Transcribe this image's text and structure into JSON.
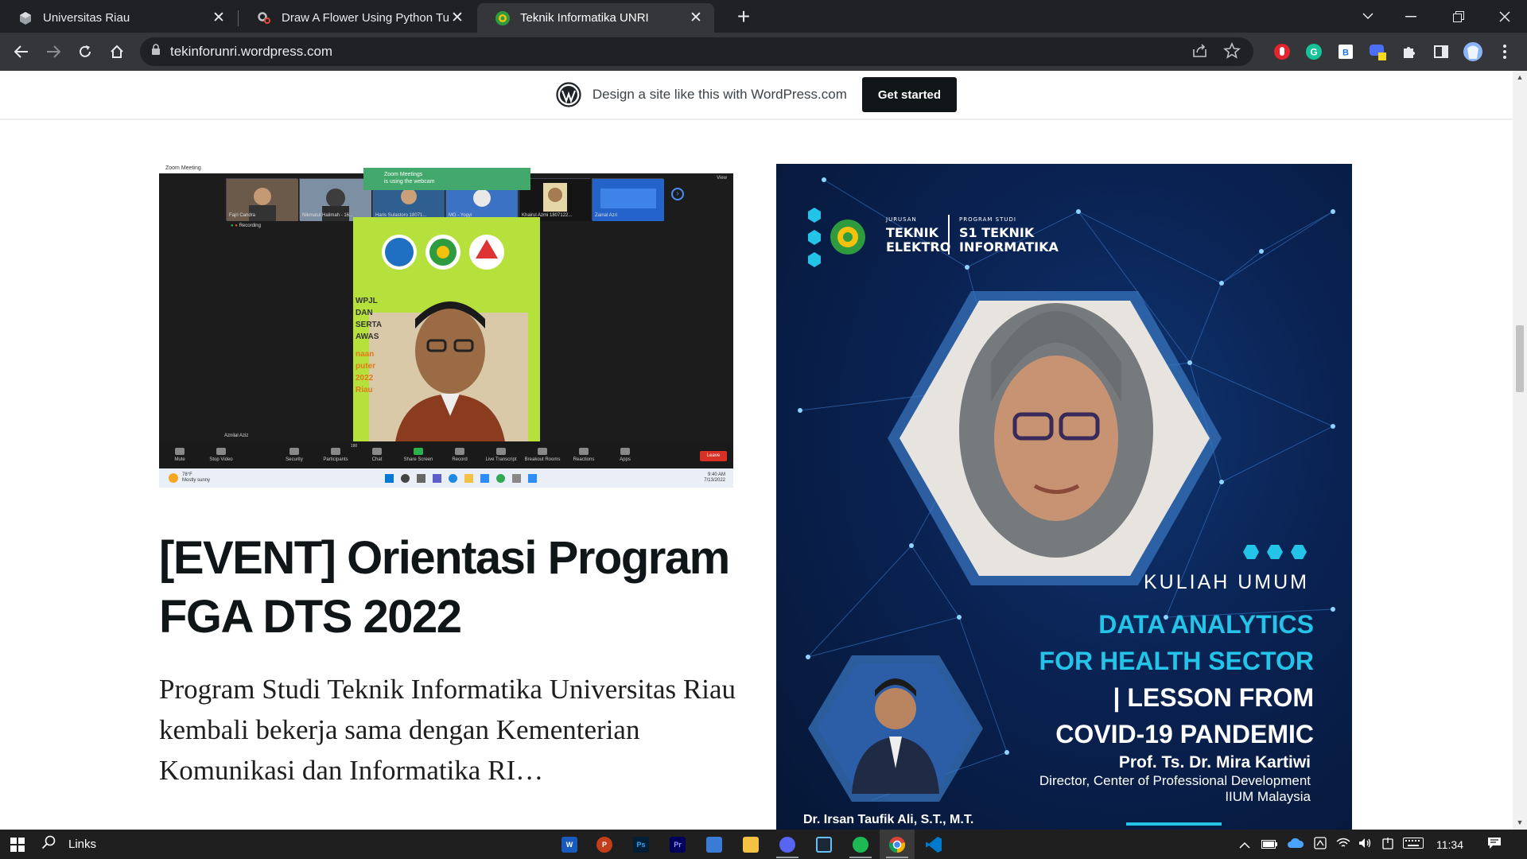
{
  "browser": {
    "tabs": [
      {
        "title": "Universitas Riau",
        "active": false,
        "favicon": "cube-icon"
      },
      {
        "title": "Draw A Flower Using Python Turtle",
        "active": false,
        "favicon": "gears-icon"
      },
      {
        "title": "Teknik Informatika UNRI",
        "active": true,
        "favicon": "unri-logo-icon"
      }
    ],
    "address": "tekinforunri.wordpress.com",
    "accent": "#35363a"
  },
  "wp_banner": {
    "tagline": "Design a site like this with WordPress.com",
    "cta": "Get started"
  },
  "post": {
    "title": " [EVENT] Orientasi Program FGA DTS 2022",
    "excerpt": " Program Studi Teknik Informatika Universitas Riau kembali bekerja sama dengan Kementerian Komunikasi dan Informatika RI…"
  },
  "zoom": {
    "window_title": "Zoom Meeting",
    "notice_line1": "Zoom Meetings",
    "notice_line2": "is using the webcam",
    "participants": [
      "Fajri Candra",
      "Nikmatul Halimah - 16...",
      "Haris Sulastoro 18071...",
      "MG - Yogyi",
      "Khairul Azmi 1807122...",
      "Zainal Azri"
    ],
    "recording": "Recording",
    "speaker_name": "Aznilal Aziz",
    "slide_text_dark": [
      "WPJL",
      "DAN",
      "SERTA",
      "AWAS"
    ],
    "slide_text_orange": [
      "naan",
      "puter",
      "2022",
      "Riau"
    ],
    "controls": [
      "Mute",
      "Stop Video",
      "Security",
      "Participants",
      "Chat",
      "Share Screen",
      "Record",
      "Live Transcript",
      "Breakout Rooms",
      "Reactions",
      "Apps"
    ],
    "participant_count": "180",
    "leave": "Leave",
    "weather_temp": "78°F",
    "weather_desc": "Mostly sunny",
    "clock_time": "9:40 AM",
    "clock_date": "7/13/2022",
    "view_label": "View"
  },
  "poster": {
    "jurusan_small": "JURUSAN",
    "jurusan_big1": "TEKNIK",
    "jurusan_big2": "ELEKTRO",
    "prodi_small": "PROGRAM STUDI",
    "prodi_big1": "S1 TEKNIK",
    "prodi_big2": "INFORMATIKA",
    "kuliah": "KULIAH UMUM",
    "title_line1": "DATA ANALYTICS",
    "title_line2": "FOR HEALTH SECTOR",
    "title_line3": "| LESSON FROM",
    "title_line4": "COVID-19 PANDEMIC",
    "speaker": "Prof. Ts. Dr. Mira Kartiwi",
    "role_line1": "Director, Center of Professional Development",
    "role_line2": "IIUM Malaysia",
    "moderator": "Dr. Irsan Taufik Ali, S.T., M.T.",
    "accent": "#24c3e8"
  },
  "taskbar": {
    "search_label": "Links",
    "time": "11:34",
    "apps": [
      {
        "name": "word",
        "label": "W",
        "color": "#185abd"
      },
      {
        "name": "powerpoint",
        "label": "P",
        "color": "#c43e1c"
      },
      {
        "name": "photoshop",
        "label": "Ps",
        "color": "#001e36"
      },
      {
        "name": "premiere",
        "label": "Pr",
        "color": "#00005b"
      },
      {
        "name": "photos",
        "label": "",
        "color": "#3a7bd5"
      },
      {
        "name": "file-explorer",
        "label": "",
        "color": "#f3c242"
      },
      {
        "name": "discord",
        "label": "",
        "color": "#5865f2"
      },
      {
        "name": "steam",
        "label": "",
        "color": "#1b2838"
      },
      {
        "name": "spotify",
        "label": "",
        "color": "#1db954"
      },
      {
        "name": "chrome",
        "label": "",
        "color": "#34a853"
      },
      {
        "name": "vscode",
        "label": "",
        "color": "#007acc"
      }
    ]
  }
}
